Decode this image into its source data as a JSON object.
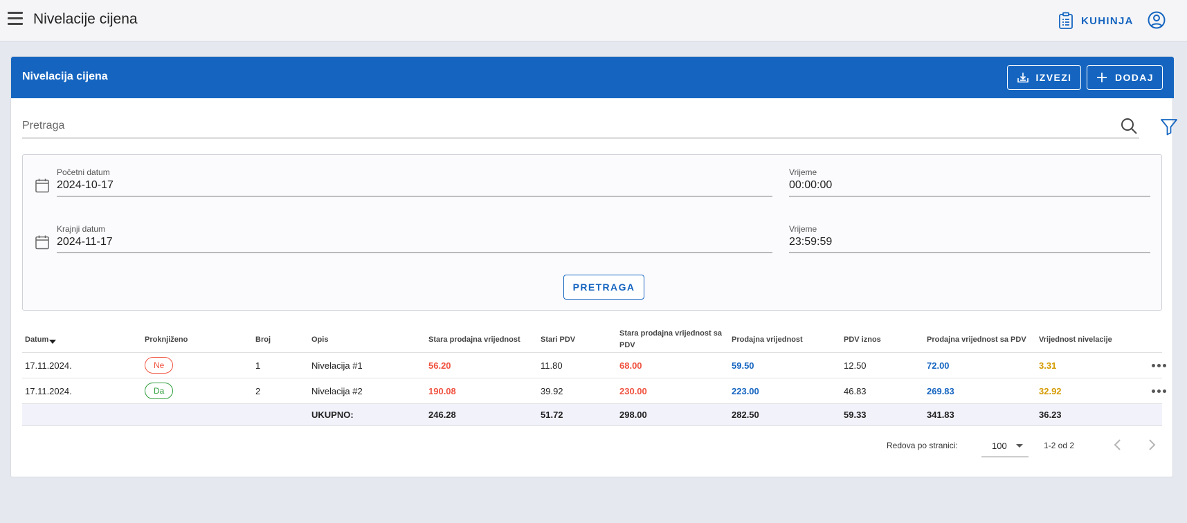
{
  "topbar": {
    "title": "Nivelacije cijena",
    "kuhinja_label": "KUHINJA"
  },
  "card": {
    "title": "Nivelacija cijena",
    "export_label": "IZVEZI",
    "add_label": "DODAJ"
  },
  "search": {
    "placeholder": "Pretraga"
  },
  "filters": {
    "start_date_label": "Početni datum",
    "start_date_value": "2024-10-17",
    "start_time_label": "Vrijeme",
    "start_time_value": "00:00:00",
    "end_date_label": "Krajnji datum",
    "end_date_value": "2024-11-17",
    "end_time_label": "Vrijeme",
    "end_time_value": "23:59:59",
    "search_button": "PRETRAGA"
  },
  "table": {
    "columns": [
      "Datum",
      "Proknjiženo",
      "Broj",
      "Opis",
      "Stara prodajna vrijednost",
      "Stari PDV",
      "Stara prodajna vrijednost sa PDV",
      "Prodajna vrijednost",
      "PDV iznos",
      "Prodajna vrijednost sa PDV",
      "Vrijednost nivelacije"
    ],
    "rows": [
      {
        "datum": "17.11.2024.",
        "proknjizeno": "Ne",
        "broj": "1",
        "opis": "Nivelacija #1",
        "stara_prodajna": "56.20",
        "stari_pdv": "11.80",
        "stara_sa_pdv": "68.00",
        "prodajna": "59.50",
        "pdv_iznos": "12.50",
        "prodajna_sa_pdv": "72.00",
        "nivelacija": "3.31"
      },
      {
        "datum": "17.11.2024.",
        "proknjizeno": "Da",
        "broj": "2",
        "opis": "Nivelacija #2",
        "stara_prodajna": "190.08",
        "stari_pdv": "39.92",
        "stara_sa_pdv": "230.00",
        "prodajna": "223.00",
        "pdv_iznos": "46.83",
        "prodajna_sa_pdv": "269.83",
        "nivelacija": "32.92"
      }
    ],
    "total": {
      "label": "UKUPNO:",
      "stara_prodajna": "246.28",
      "stari_pdv": "51.72",
      "stara_sa_pdv": "298.00",
      "prodajna": "282.50",
      "pdv_iznos": "59.33",
      "prodajna_sa_pdv": "341.83",
      "nivelacija": "36.23"
    }
  },
  "pagination": {
    "rows_per_page_label": "Redova po stranici:",
    "rows_per_page_value": "100",
    "range": "1-2 od 2"
  },
  "colors": {
    "primary": "#1565c0",
    "old_value": "#f0523f",
    "new_value": "#1565c0",
    "difference": "#d49a00",
    "badge_no": "#f0523f",
    "badge_yes": "#2e9d3a"
  },
  "icons": [
    "menu-icon",
    "clipboard-icon",
    "account-circle-icon",
    "download-icon",
    "plus-icon",
    "search-icon",
    "filter-icon",
    "calendar-icon",
    "more-horiz-icon",
    "chevron-left-icon",
    "chevron-right-icon",
    "sort-down-icon",
    "dropdown-caret-icon"
  ]
}
